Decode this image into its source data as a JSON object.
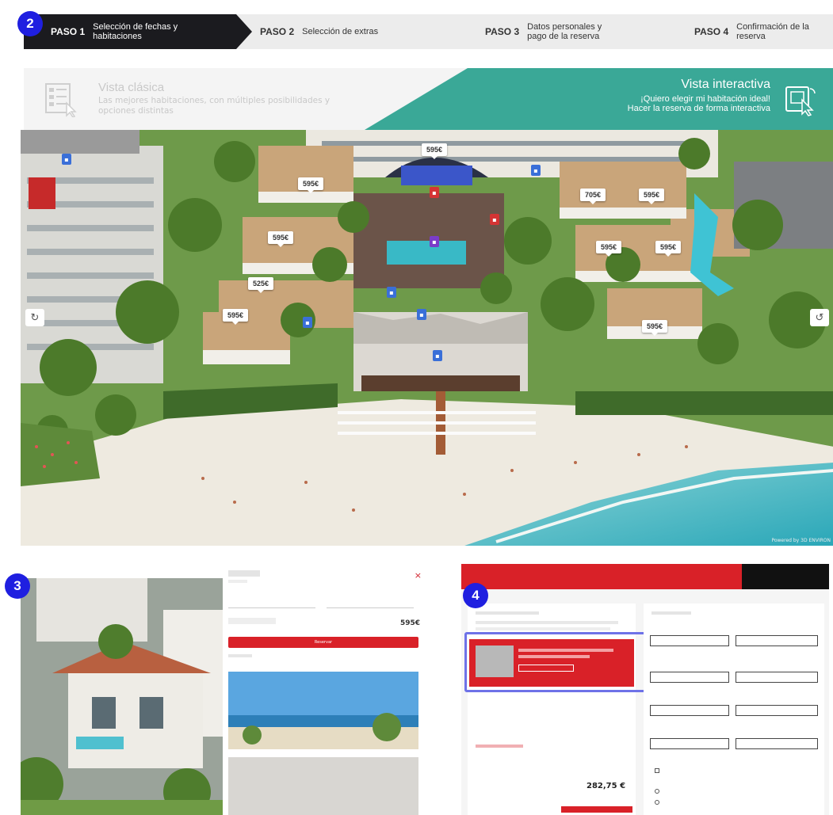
{
  "badges": [
    "2",
    "3",
    "4"
  ],
  "steps": [
    {
      "num": "PASO 1",
      "label": "Selección de fechas y habitaciones",
      "active": true
    },
    {
      "num": "PASO 2",
      "label": "Selección de extras",
      "active": false
    },
    {
      "num": "PASO 3",
      "label": "Datos personales y pago de la reserva",
      "active": false
    },
    {
      "num": "PASO 4",
      "label": "Confirmación de la reserva",
      "active": false
    }
  ],
  "view_selector": {
    "classic_title": "Vista clásica",
    "classic_desc": "Las mejores habitaciones, con múltiples posibilidades y opciones distintas",
    "interactive_title": "Vista interactiva",
    "interactive_line1": "¡Quiero elegir mi habitación ideal!",
    "interactive_line2": "Hacer la reserva de forma interactiva"
  },
  "map": {
    "prices": [
      "595€",
      "595€",
      "595€",
      "525€",
      "595€",
      "705€",
      "595€",
      "595€",
      "595€",
      "595€"
    ],
    "credit": "Powered by 3D ENVIRON",
    "colors": {
      "sea": "#49b9c4",
      "sand": "#eeeae0",
      "grass": "#6e9a4a",
      "roof": "#c9a57a"
    }
  },
  "panel3": {
    "close": "×",
    "price": "595€",
    "reserve_label": "Reservar"
  },
  "panel4": {
    "total": "282,75 €"
  },
  "colors": {
    "accent_red": "#d92128",
    "badge_blue": "#1f1fe0",
    "teal": "#3aa897",
    "dark": "#1b1b1f"
  }
}
